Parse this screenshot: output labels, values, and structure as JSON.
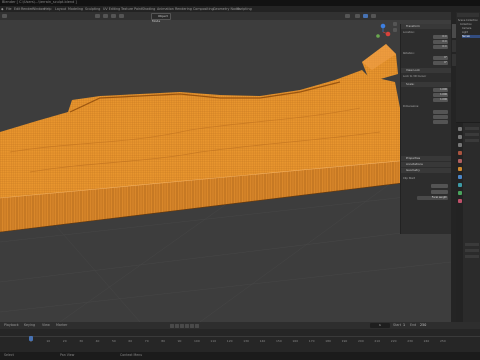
{
  "window": {
    "title": "Blender [ C:\\Users\\...\\terrain_sculpt.blend ]"
  },
  "menubar": {
    "items": [
      "File",
      "Edit",
      "Render",
      "Window",
      "Help"
    ],
    "workspaces": [
      "Layout",
      "Modeling",
      "Sculpting",
      "UV Editing",
      "Texture Paint",
      "Shading",
      "Animation",
      "Rendering",
      "Compositing",
      "Geometry Nodes",
      "Scripting"
    ],
    "active_workspace": "Layout"
  },
  "viewport": {
    "mode": "Object Mode",
    "colors": {
      "background": "#3d3d3d",
      "mesh_fill": "#e8952e",
      "mesh_wire": "#b86a15",
      "mesh_dark": "#9a5510"
    }
  },
  "sidebar": {
    "header_tabs": [
      "Item",
      "Tool",
      "View"
    ],
    "transform_title": "Transform",
    "location_label": "Location:",
    "location": {
      "x": "0 m",
      "y": "0 m",
      "z": "0 m"
    },
    "rotation_label": "Rotation:",
    "rotation": {
      "x": "0°",
      "y": "0°",
      "z": "0°"
    },
    "scale_label": "Scale:",
    "scale": {
      "x": "1.000",
      "y": "1.000",
      "z": "1.000"
    },
    "dimensions_label": "Dimensions:",
    "sections": [
      "Properties",
      "Annotations",
      "Geometry"
    ],
    "view_lock": "View Lock",
    "lock_to_object": "Lock to 3D Cursor",
    "clip_start": "Clip Start",
    "clip_end": "End",
    "focal_length": "Focal Length"
  },
  "outliner": {
    "title": "Scene Collection",
    "items": [
      "Collection",
      "Camera",
      "Light",
      "Terrain"
    ]
  },
  "timeline": {
    "playback_label": "Playback",
    "keying_label": "Keying",
    "view_label": "View",
    "marker_label": "Marker",
    "current_frame": "1",
    "start_label": "Start",
    "start": "1",
    "end_label": "End",
    "end": "250",
    "ticks": [
      "0",
      "10",
      "20",
      "30",
      "40",
      "50",
      "60",
      "70",
      "80",
      "90",
      "100",
      "110",
      "120",
      "130",
      "140",
      "150",
      "160",
      "170",
      "180",
      "190",
      "200",
      "210",
      "220",
      "230",
      "240",
      "250"
    ]
  },
  "statusbar": {
    "left": "Select",
    "middle": "Pan View",
    "right": "Context Menu"
  }
}
